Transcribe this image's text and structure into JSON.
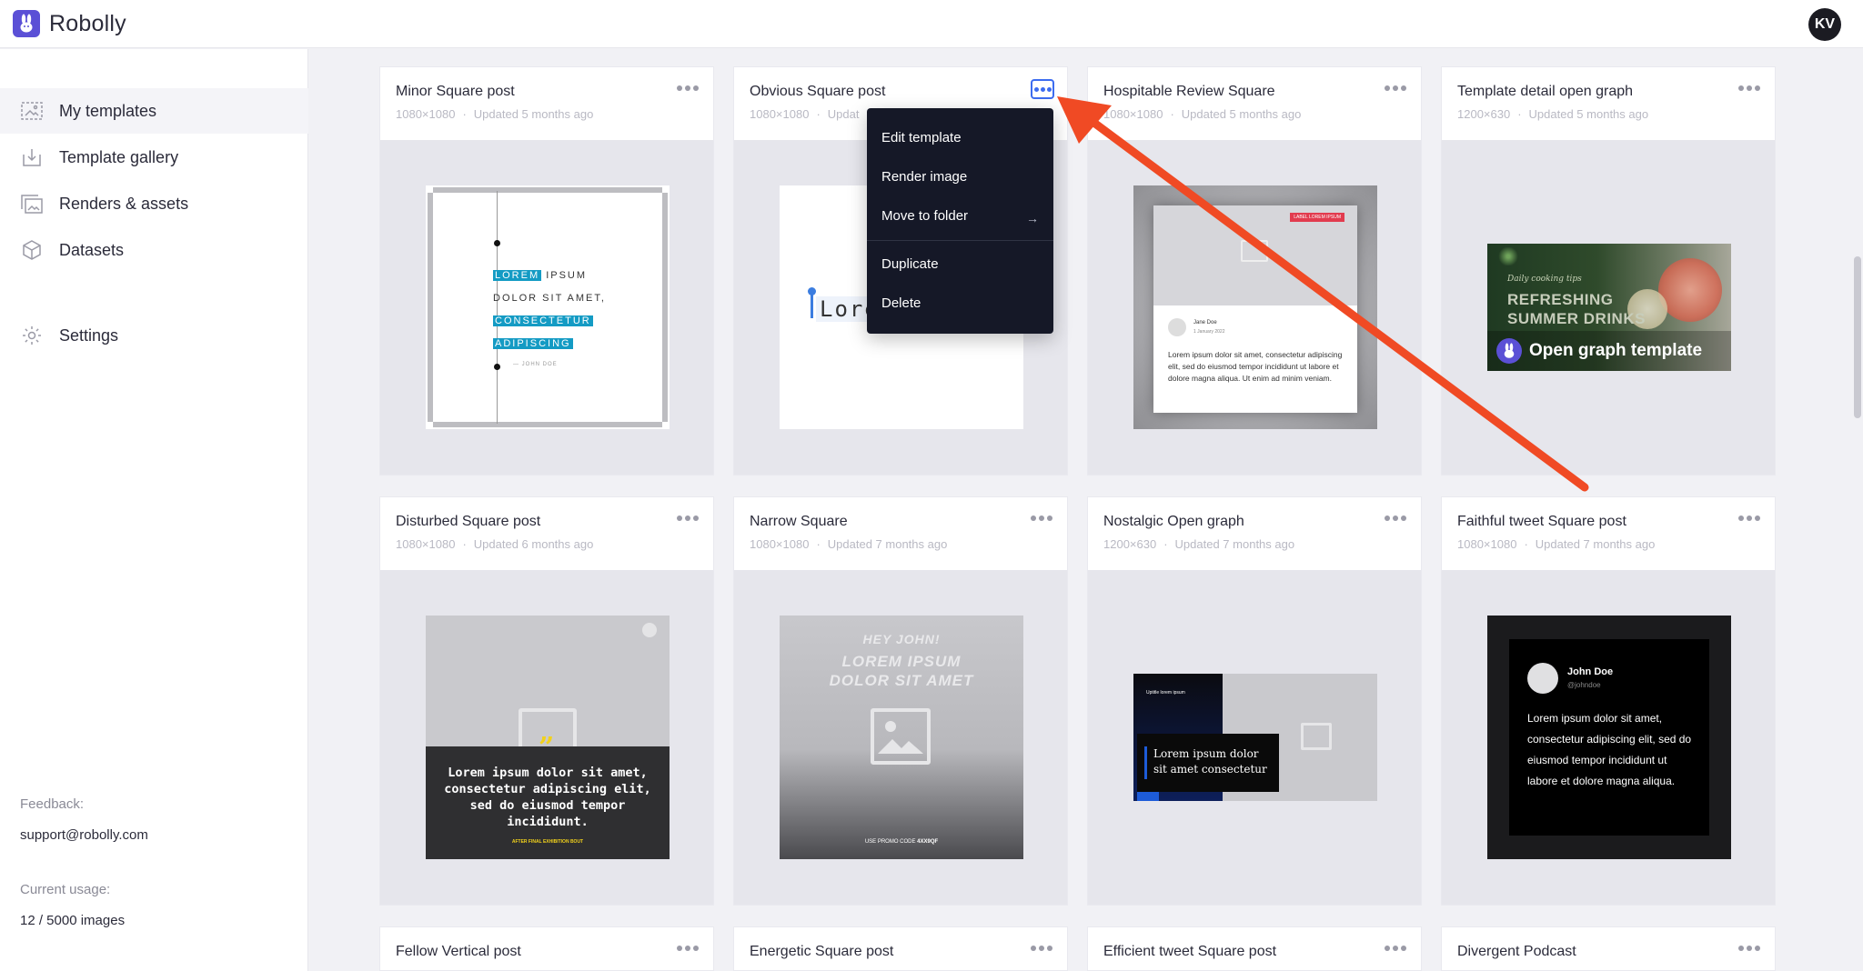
{
  "app": {
    "name": "Robolly",
    "user_initials": "KV"
  },
  "colors": {
    "accent": "#5b50d6",
    "menu_bg": "#151827",
    "active_border": "#3c6cf0",
    "annotation_arrow": "#f04a24"
  },
  "sidebar": {
    "items": [
      {
        "label": "My templates",
        "icon": "image-gallery-icon"
      },
      {
        "label": "Template gallery",
        "icon": "download-tray-icon"
      },
      {
        "label": "Renders & assets",
        "icon": "images-stack-icon"
      },
      {
        "label": "Datasets",
        "icon": "cube-icon"
      },
      {
        "label": "Settings",
        "icon": "gear-icon"
      }
    ],
    "feedback_label": "Feedback:",
    "feedback_email": "support@robolly.com",
    "usage_label": "Current usage:",
    "usage_value": "12 / 5000 images"
  },
  "context_menu": {
    "items": [
      "Edit template",
      "Render image",
      "Move to folder",
      "Duplicate",
      "Delete"
    ],
    "submenu_arrow": "→"
  },
  "cards": [
    {
      "title": "Minor Square post",
      "size": "1080×1080",
      "updated": "Updated 5 months ago"
    },
    {
      "title": "Obvious Square post",
      "size": "1080×1080",
      "updated": "Updat"
    },
    {
      "title": "Hospitable Review Square",
      "size": "1080×1080",
      "updated": "Updated 5 months ago"
    },
    {
      "title": "Template detail open graph",
      "size": "1200×630",
      "updated": "Updated 5 months ago"
    },
    {
      "title": "Disturbed Square post",
      "size": "1080×1080",
      "updated": "Updated 6 months ago"
    },
    {
      "title": "Narrow Square",
      "size": "1080×1080",
      "updated": "Updated 7 months ago"
    },
    {
      "title": "Nostalgic Open graph",
      "size": "1200×630",
      "updated": "Updated 7 months ago"
    },
    {
      "title": "Faithful tweet Square post",
      "size": "1080×1080",
      "updated": "Updated 7 months ago"
    },
    {
      "title": "Fellow Vertical post",
      "size": "",
      "updated": ""
    },
    {
      "title": "Energetic Square post",
      "size": "",
      "updated": ""
    },
    {
      "title": "Efficient tweet Square post",
      "size": "",
      "updated": ""
    },
    {
      "title": "Divergent Podcast",
      "size": "",
      "updated": ""
    }
  ],
  "thumbs": {
    "minor": {
      "lines": [
        "LOREM",
        "IPSUM",
        "DOLOR SIT AMET,",
        "CONSECTETUR",
        "ADIPISCING"
      ],
      "author": "— JOHN DOE"
    },
    "obvious": {
      "text": "Lore"
    },
    "review": {
      "badge": "LABEL LOREM IPSUM",
      "name": "Jane Doe",
      "date": "1 January 2022",
      "body": "Lorem ipsum dolor sit amet, consectetur adipiscing elit, sed do eiusmod tempor incididunt ut labore et dolore magna aliqua. Ut enim ad minim veniam."
    },
    "og": {
      "kicker": "Daily cooking tips",
      "line1": "REFRESHING",
      "line2": "SUMMER DRINKS",
      "label": "Open graph template"
    },
    "disturbed": {
      "quote_mark": "”",
      "body": "Lorem ipsum dolor sit amet, consectetur adipiscing elit, sed do eiusmod tempor incididunt.",
      "footer": "AFTER FINAL EXHIBITION BOUT"
    },
    "narrow": {
      "line1": "HEY JOHN!",
      "line2": "LOREM IPSUM DOLOR SIT AMET",
      "promo": "USE PROMO CODE",
      "code": "4XX9QF"
    },
    "nostalgic": {
      "kicker": "Uptitle lorem ipsum",
      "body": "Lorem ipsum dolor sit amet consectetur"
    },
    "faithful": {
      "name": "John Doe",
      "handle": "@johndoe",
      "body": "Lorem ipsum dolor sit amet, consectetur adipiscing elit, sed do eiusmod tempor incididunt ut labore et dolore magna aliqua."
    }
  }
}
